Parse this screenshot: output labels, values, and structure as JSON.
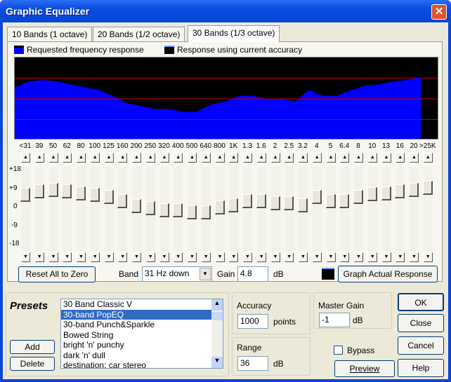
{
  "window": {
    "title": "Graphic Equalizer",
    "close": "✕"
  },
  "tabs": [
    {
      "label": "10 Bands (1 octave)"
    },
    {
      "label": "20 Bands (1/2 octave)"
    },
    {
      "label": "30 Bands (1/3 octave)",
      "active": true
    }
  ],
  "legend": {
    "requested": "Requested frequency response",
    "actual": "Response using current accuracy"
  },
  "colors": {
    "fill": "#0000ff",
    "grid": "#c00000",
    "bg": "#000000"
  },
  "scale_labels": [
    "+18",
    "+9",
    "0",
    "-9",
    "-18"
  ],
  "bands": [
    {
      "label": "<31",
      "gain": 4
    },
    {
      "label": "39",
      "gain": 6
    },
    {
      "label": "50",
      "gain": 6.5
    },
    {
      "label": "62",
      "gain": 6
    },
    {
      "label": "80",
      "gain": 5
    },
    {
      "label": "100",
      "gain": 4
    },
    {
      "label": "125",
      "gain": 3
    },
    {
      "label": "160",
      "gain": 1
    },
    {
      "label": "200",
      "gain": -1.5
    },
    {
      "label": "250",
      "gain": -2.5
    },
    {
      "label": "320",
      "gain": -3.5
    },
    {
      "label": "400",
      "gain": -3.5
    },
    {
      "label": "500",
      "gain": -4.5
    },
    {
      "label": "640",
      "gain": -4.5
    },
    {
      "label": "800",
      "gain": -2
    },
    {
      "label": "1K",
      "gain": -1
    },
    {
      "label": "1.3",
      "gain": 1
    },
    {
      "label": "1.6",
      "gain": 1
    },
    {
      "label": "2",
      "gain": 0
    },
    {
      "label": "2.5",
      "gain": 0
    },
    {
      "label": "3.2",
      "gain": -1
    },
    {
      "label": "4",
      "gain": 3
    },
    {
      "label": "5",
      "gain": 1
    },
    {
      "label": "6.4",
      "gain": 1
    },
    {
      "label": "8",
      "gain": 3
    },
    {
      "label": "10",
      "gain": 4.5
    },
    {
      "label": "13",
      "gain": 5
    },
    {
      "label": "16",
      "gain": 6
    },
    {
      "label": "20",
      "gain": 6.5
    },
    {
      "label": ">25K",
      "gain": 7.5
    }
  ],
  "controls": {
    "reset": "Reset All to Zero",
    "band_label": "Band",
    "band_value": "31 Hz down",
    "gain_label": "Gain",
    "gain_value": "4.8",
    "gain_unit": "dB",
    "graph_actual": "Graph Actual Response"
  },
  "presets": {
    "title": "Presets",
    "add": "Add",
    "delete": "Delete",
    "items": [
      "30 Band Classic V",
      "30-band PopEQ",
      "30-band Punch&Sparkle",
      "Bowed String",
      "bright 'n' punchy",
      "dark 'n' dull",
      "destination: car stereo"
    ],
    "selected": 1
  },
  "accuracy": {
    "label": "Accuracy",
    "value": "1000",
    "unit": "points"
  },
  "range": {
    "label": "Range",
    "value": "36",
    "unit": "dB"
  },
  "master_gain": {
    "label": "Master Gain",
    "value": "-1",
    "unit": "dB"
  },
  "bypass": {
    "label": "Bypass",
    "checked": false
  },
  "buttons": {
    "ok": "OK",
    "close": "Close",
    "cancel": "Cancel",
    "help": "Help",
    "preview": "Preview"
  }
}
